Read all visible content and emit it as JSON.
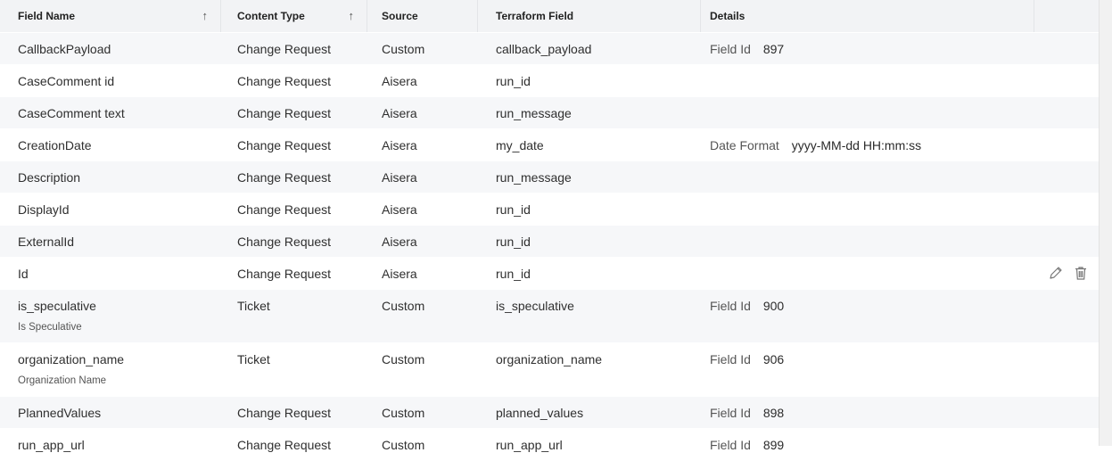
{
  "columns": [
    {
      "label": "Field Name",
      "sortable": true
    },
    {
      "label": "Content Type",
      "sortable": true
    },
    {
      "label": "Source",
      "sortable": false
    },
    {
      "label": "Terraform Field",
      "sortable": false
    },
    {
      "label": "Details",
      "sortable": false
    },
    {
      "label": "",
      "sortable": false
    }
  ],
  "rows": [
    {
      "name": "CallbackPayload",
      "sub": "",
      "type": "Change Request",
      "source": "Custom",
      "tf": "callback_payload",
      "detail_label": "Field Id",
      "detail_value": "897"
    },
    {
      "name": "CaseComment id",
      "sub": "",
      "type": "Change Request",
      "source": "Aisera",
      "tf": "run_id",
      "detail_label": "",
      "detail_value": ""
    },
    {
      "name": "CaseComment text",
      "sub": "",
      "type": "Change Request",
      "source": "Aisera",
      "tf": "run_message",
      "detail_label": "",
      "detail_value": ""
    },
    {
      "name": "CreationDate",
      "sub": "",
      "type": "Change Request",
      "source": "Aisera",
      "tf": "my_date",
      "detail_label": "Date Format",
      "detail_value": "yyyy-MM-dd HH:mm:ss"
    },
    {
      "name": "Description",
      "sub": "",
      "type": "Change Request",
      "source": "Aisera",
      "tf": "run_message",
      "detail_label": "",
      "detail_value": ""
    },
    {
      "name": "DisplayId",
      "sub": "",
      "type": "Change Request",
      "source": "Aisera",
      "tf": "run_id",
      "detail_label": "",
      "detail_value": ""
    },
    {
      "name": "ExternalId",
      "sub": "",
      "type": "Change Request",
      "source": "Aisera",
      "tf": "run_id",
      "detail_label": "",
      "detail_value": ""
    },
    {
      "name": "Id",
      "sub": "",
      "type": "Change Request",
      "source": "Aisera",
      "tf": "run_id",
      "detail_label": "",
      "detail_value": "",
      "show_actions": true
    },
    {
      "name": "is_speculative",
      "sub": "Is Speculative",
      "type": "Ticket",
      "source": "Custom",
      "tf": "is_speculative",
      "detail_label": "Field Id",
      "detail_value": "900"
    },
    {
      "name": "organization_name",
      "sub": "Organization Name",
      "type": "Ticket",
      "source": "Custom",
      "tf": "organization_name",
      "detail_label": "Field Id",
      "detail_value": "906"
    },
    {
      "name": "PlannedValues",
      "sub": "",
      "type": "Change Request",
      "source": "Custom",
      "tf": "planned_values",
      "detail_label": "Field Id",
      "detail_value": "898"
    },
    {
      "name": "run_app_url",
      "sub": "",
      "type": "Change Request",
      "source": "Custom",
      "tf": "run_app_url",
      "detail_label": "Field Id",
      "detail_value": "899"
    }
  ],
  "icons": {
    "sort": "arrow-up-icon",
    "edit": "pencil-icon",
    "delete": "trash-icon"
  },
  "colors": {
    "header_bg": "#f2f3f5",
    "alt_row_bg": "#f6f7f9"
  }
}
